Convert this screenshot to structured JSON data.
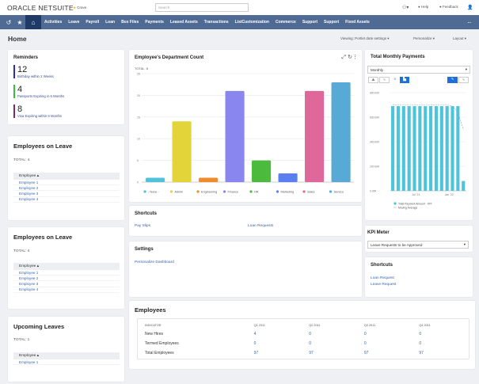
{
  "header": {
    "logo": "ORACLE NETSUITE",
    "company": "Crave",
    "search_placeholder": "Search",
    "help": "Help",
    "feedback": "Feedback"
  },
  "nav": {
    "items": [
      "Activities",
      "Leave",
      "Payroll",
      "Loan",
      "Box Files",
      "Payments",
      "Leased Assets",
      "Transactions",
      "ListCustomization",
      "Commerce",
      "Support",
      "Support",
      "Fixed Assets"
    ],
    "more": "..."
  },
  "page": {
    "title": "Home",
    "viewing": "Viewing: Portlet date settings ▾",
    "personalize": "Personalize ▾",
    "layout": "Layout ▾"
  },
  "reminders": {
    "title": "Reminders",
    "items": [
      {
        "count": "12",
        "label": "Birthday within 2 Weeks",
        "color": "#2b2fa8"
      },
      {
        "count": "4",
        "label": "Passports Expiring in 6 Months",
        "color": "#3cba3c"
      },
      {
        "count": "8",
        "label": "Visa Expiring within 6 Months",
        "color": "#7a2a6e"
      }
    ]
  },
  "leave1": {
    "title": "Employees on Leave",
    "total": "TOTAL: 4",
    "header": "Employee ▴",
    "rows": [
      "Employee 1",
      "Employee 2",
      "Employee 3",
      "Employee 4"
    ]
  },
  "leave2": {
    "title": "Employees on Leave",
    "total": "TOTAL: 4",
    "header": "Employee ▴",
    "rows": [
      "Employee 1",
      "Employee 2",
      "Employee 3",
      "Employee 4"
    ]
  },
  "upcoming": {
    "title": "Upcoming Leaves",
    "total": "TOTAL: 1",
    "header": "Employee ▴",
    "rows": [
      "Employee 1"
    ]
  },
  "dept_chart": {
    "title": "Employee's Department Count",
    "total": "TOTAL: 8"
  },
  "payments": {
    "title": "Total Monthly Payments",
    "period": "Monthly"
  },
  "shortcuts_mid": {
    "title": "Shortcuts",
    "links": [
      "Pay Slips",
      "Loan Requests"
    ]
  },
  "settings": {
    "title": "Settings",
    "links": [
      "Personalize Dashboard"
    ]
  },
  "kpi": {
    "title": "KPI Meter",
    "selected": "Leave Requests to be Approved"
  },
  "shortcuts_right": {
    "title": "Shortcuts",
    "links": [
      "Loan Request",
      "Leave Request"
    ]
  },
  "employees": {
    "title": "Employees",
    "columns": [
      "INDICATOR",
      "Q1 2011",
      "Q2 2011",
      "Q3 2011",
      "Q4 2011"
    ],
    "rows": [
      [
        "New Hires",
        "4",
        "0",
        "0",
        "0"
      ],
      [
        "Termed Employees",
        "0",
        "0",
        "0",
        "0"
      ],
      [
        "Total Employees",
        "97",
        "97",
        "97",
        "97"
      ]
    ]
  },
  "chart_data": [
    {
      "type": "bar",
      "categories": [
        "- None -",
        "Admin",
        "Engineering",
        "Finance",
        "HR",
        "Marketing",
        "Sales",
        "Service"
      ],
      "values": [
        1,
        14,
        1,
        21,
        5,
        2,
        21,
        23
      ],
      "colors": [
        "#4fc3dc",
        "#e3d43a",
        "#f08a2a",
        "#8a86f0",
        "#4cba3c",
        "#5b7ef0",
        "#e0679a",
        "#58a9d6"
      ],
      "yticks": [
        "0",
        "5",
        "10",
        "15",
        "20",
        "25"
      ],
      "ylim": [
        0,
        25
      ],
      "legend": "bottom",
      "grid": true
    },
    {
      "type": "bar",
      "ylim": [
        0,
        800
      ],
      "yticks": [
        "0.00K",
        "200.00K",
        "400.00K",
        "600.00K",
        "800.00K"
      ],
      "xticks": [
        "Jul '21",
        "Jan '22"
      ],
      "series": [
        {
          "name": "Total Payment Amount - KPI",
          "values": [
            690,
            690,
            690,
            690,
            690,
            690,
            690,
            690,
            690,
            690,
            690,
            690,
            690,
            80
          ],
          "color": "#4bc4dc"
        },
        {
          "name": "Moving Average",
          "type": "line",
          "values": [
            700,
            700,
            700,
            700,
            700,
            700,
            700,
            700,
            700,
            700,
            700,
            690,
            640,
            500
          ],
          "color": "#9ab"
        }
      ],
      "legend": "bottom",
      "grid": true
    }
  ]
}
